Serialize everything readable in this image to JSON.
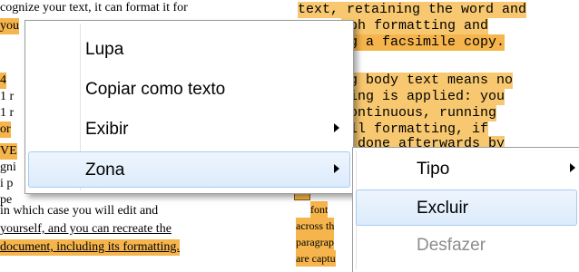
{
  "document": {
    "left_lines": [
      "cognize your text, it can format it for",
      "you",
      "4",
      "1 r",
      "1 r",
      "or",
      "VE",
      "gni",
      "i p",
      "pe",
      "in which case you will edit and",
      "yourself, and you can recreate the",
      "document, including its formatting."
    ],
    "right_lines": [
      "text, retaining the word and",
      "aph formatting and",
      "ng a facsimile copy.",
      "ng body text means no",
      "ting is applied: you",
      "continuous, running",
      "All formatting, if",
      "e done afterwards by",
      "font",
      "across th",
      "paragrap",
      "are captu"
    ]
  },
  "context_menu": {
    "items": [
      {
        "label": "Lupa",
        "has_submenu": false
      },
      {
        "label": "Copiar como texto",
        "has_submenu": false
      },
      {
        "label": "Exibir",
        "has_submenu": true
      },
      {
        "label": "Zona",
        "has_submenu": true,
        "selected": true
      }
    ]
  },
  "submenu": {
    "items": [
      {
        "label": "Tipo",
        "has_submenu": true
      },
      {
        "label": "Excluir",
        "has_submenu": false,
        "selected": true
      },
      {
        "label": "Desfazer",
        "has_submenu": false,
        "disabled": true
      }
    ]
  },
  "colors": {
    "highlight": "#f5b54c",
    "menu_selected": "#dcebfc",
    "disabled_text": "#8c8c8c"
  }
}
